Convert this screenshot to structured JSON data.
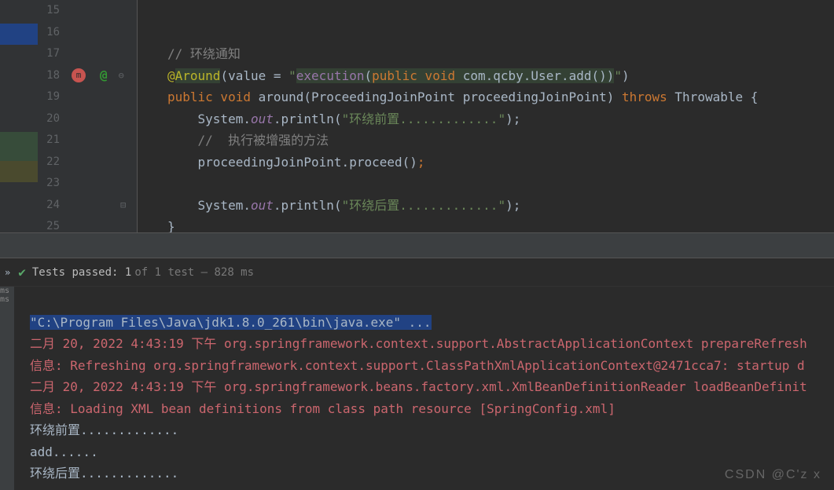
{
  "gutter": {
    "start": 15,
    "end": 25
  },
  "code": {
    "l16_comment": "// 环绕通知",
    "l17_at": "@",
    "l17_around": "Around",
    "l17_value": "(value = ",
    "l17_q1": "\"",
    "l17_exec": "execution",
    "l17_p1": "(",
    "l17_pubvoid": "public void",
    "l17_sig": " com.qcby.User.add()",
    "l17_p2": ")",
    "l17_q2": "\"",
    "l17_close": ")",
    "l18_public": "public",
    "l18_void": " void",
    "l18_around": " around",
    "l18_params": "(ProceedingJoinPoint proceedingJoinPoint) ",
    "l18_throws": "throws",
    "l18_throwable": " Throwable {",
    "l19_sys": "System.",
    "l19_out": "out",
    "l19_println": ".println(",
    "l19_str": "\"环绕前置.............\"",
    "l19_end": ");",
    "l20_comment": "//  执行被增强的方法",
    "l21_text": "proceedingJoinPoint.proceed()",
    "l21_semi": ";",
    "l23_sys": "System.",
    "l23_out": "out",
    "l23_println": ".println(",
    "l23_str": "\"环绕后置.............\"",
    "l23_end": ");",
    "l24_brace": "}"
  },
  "testbar": {
    "chevrons": "»",
    "prefix": "Tests passed: 1",
    "detail": "of 1 test – 828 ms"
  },
  "console": {
    "cmd": "\"C:\\Program Files\\Java\\jdk1.8.0_261\\bin\\java.exe\" ...",
    "l1": "二月 20, 2022 4:43:19 下午 org.springframework.context.support.AbstractApplicationContext prepareRefresh",
    "l2": "信息: Refreshing org.springframework.context.support.ClassPathXmlApplicationContext@2471cca7: startup d",
    "l3": "二月 20, 2022 4:43:19 下午 org.springframework.beans.factory.xml.XmlBeanDefinitionReader loadBeanDefinit",
    "l4": "信息: Loading XML bean definitions from class path resource [SpringConfig.xml]",
    "l5": "环绕前置.............",
    "l6": "add......",
    "l7": "环绕后置............."
  },
  "leftTabs": {
    "t1": "ms",
    "t2": "ms"
  },
  "watermark": "CSDN @C'z x"
}
